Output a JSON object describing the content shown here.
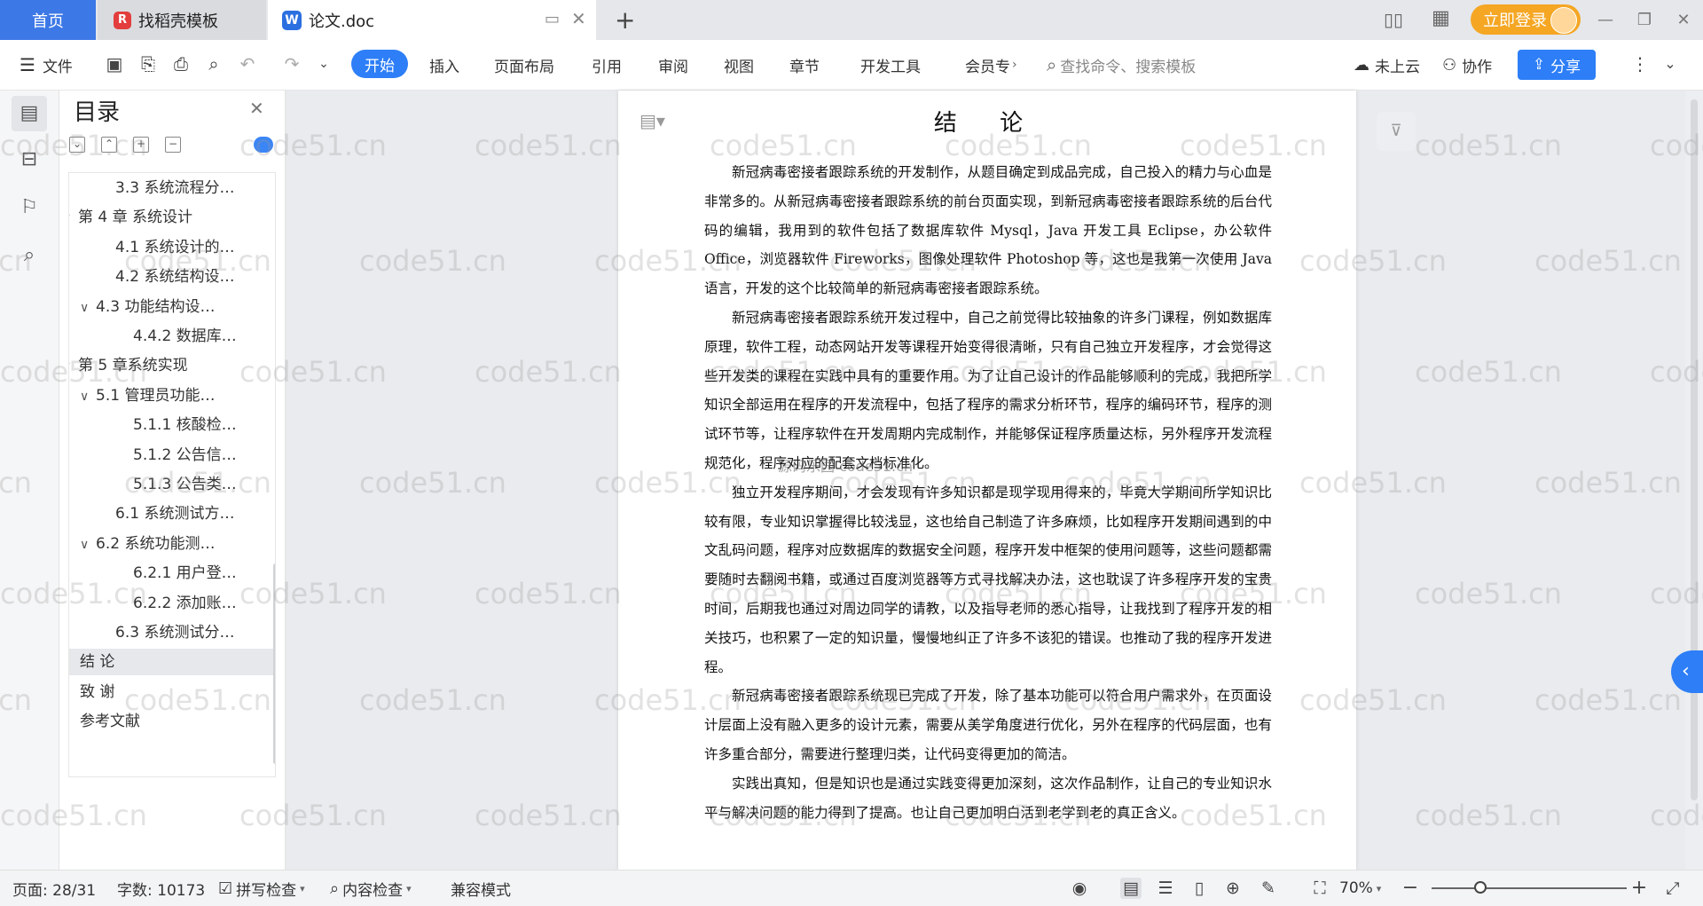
{
  "titlebar": {
    "tab_home": "首页",
    "tab_template": "找稻壳模板",
    "tab_document": "论文.doc",
    "login_label": "立即登录"
  },
  "toolbar": {
    "file_label": "文件",
    "tabs": [
      "开始",
      "插入",
      "页面布局",
      "引用",
      "审阅",
      "视图",
      "章节",
      "开发工具",
      "会员专"
    ],
    "search_placeholder": "查找命令、搜索模板",
    "cloud_label": "未上云",
    "collab_label": "协作",
    "share_label": "分享"
  },
  "toc": {
    "title": "目录",
    "items": [
      {
        "label": "3.3 系统流程分…",
        "level": 3,
        "caret": false,
        "selected": false
      },
      {
        "label": "第 4 章  系统设计",
        "level": 1,
        "caret": true,
        "selected": false
      },
      {
        "label": "4.1  系统设计的…",
        "level": 3,
        "caret": false,
        "selected": false
      },
      {
        "label": "4.2  系统结构设…",
        "level": 3,
        "caret": false,
        "selected": false
      },
      {
        "label": "4.3 功能结构设…",
        "level": 2,
        "caret": true,
        "selected": false
      },
      {
        "label": "4.4.2  数据库…",
        "level": 4,
        "caret": false,
        "selected": false
      },
      {
        "label": "第 5 章系统实现",
        "level": 1,
        "caret": true,
        "selected": false
      },
      {
        "label": "5.1 管理员功能…",
        "level": 2,
        "caret": true,
        "selected": false
      },
      {
        "label": "5.1.1  核酸检…",
        "level": 5,
        "caret": false,
        "selected": false
      },
      {
        "label": "5.1.2  公告信…",
        "level": 5,
        "caret": false,
        "selected": false
      },
      {
        "label": "5.1.3 公告类…",
        "level": 5,
        "caret": false,
        "selected": false
      },
      {
        "label": "6.1 系统测试方…",
        "level": 3,
        "caret": false,
        "selected": false
      },
      {
        "label": "6.2  系统功能测…",
        "level": 2,
        "caret": true,
        "selected": false
      },
      {
        "label": "6.2.1  用户登…",
        "level": 5,
        "caret": false,
        "selected": false
      },
      {
        "label": "6.2.2  添加账…",
        "level": 5,
        "caret": false,
        "selected": false
      },
      {
        "label": "6.3  系统测试分…",
        "level": 3,
        "caret": false,
        "selected": false
      },
      {
        "label": "结    论",
        "level": 1,
        "caret": false,
        "selected": true
      },
      {
        "label": "致    谢",
        "level": 1,
        "caret": false,
        "selected": false
      },
      {
        "label": "参考文献",
        "level": 1,
        "caret": false,
        "selected": false
      }
    ]
  },
  "document": {
    "title": "结  论",
    "paragraphs": [
      "新冠病毒密接者跟踪系统的开发制作，从题目确定到成品完成，自己投入的精力与心血是非常多的。从新冠病毒密接者跟踪系统的前台页面实现，到新冠病毒密接者跟踪系统的后台代码的编辑，我用到的软件包括了数据库软件 Mysql，Java 开发工具 Eclipse，办公软件 Office，浏览器软件 Fireworks，图像处理软件 Photoshop 等，这也是我第一次使用 Java 语言，开发的这个比较简单的新冠病毒密接者跟踪系统。",
      "新冠病毒密接者跟踪系统开发过程中，自己之前觉得比较抽象的许多门课程，例如数据库原理，软件工程，动态网站开发等课程开始变得很清晰，只有自己独立开发程序，才会觉得这些开发类的课程在实践中具有的重要作用。为了让自己设计的作品能够顺利的完成，我把所学知识全部运用在程序的开发流程中，包括了程序的需求分析环节，程序的编码环节，程序的测试环节等，让程序软件在开发周期内完成制作，并能够保证程序质量达标，另外程序开发流程规范化，程序对应的配套文档标准化。",
      "独立开发程序期间，才会发现有许多知识都是现学现用得来的，毕竟大学期间所学知识比较有限，专业知识掌握得比较浅显，这也给自己制造了许多麻烦，比如程序开发期间遇到的中文乱码问题，程序对应数据库的数据安全问题，程序开发中框架的使用问题等，这些问题都需要随时去翻阅书籍，或通过百度浏览器等方式寻找解决办法，这也耽误了许多程序开发的宝贵时间，后期我也通过对周边同学的请教，以及指导老师的悉心指导，让我找到了程序开发的相关技巧，也积累了一定的知识量，慢慢地纠正了许多不该犯的错误。也推动了我的程序开发进程。",
      "新冠病毒密接者跟踪系统现已完成了开发，除了基本功能可以符合用户需求外，在页面设计层面上没有融入更多的设计元素，需要从美学角度进行优化，另外在程序的代码层面，也有许多重合部分，需要进行整理归类，让代码变得更加的简洁。",
      "实践出真知，但是知识也是通过实践变得更加深刻，这次作品制作，让自己的专业知识水平与解决问题的能力得到了提高。也让自己更加明白活到老学到老的真正含义。"
    ],
    "overlay_text": "源码乐园 code51.cn"
  },
  "watermark": "code51.cn",
  "statusbar": {
    "page": "页面: 28/31",
    "words": "字数: 10173",
    "spell_check": "拼写检查",
    "content_check": "内容检查",
    "compat_mode": "兼容模式",
    "zoom": "70%",
    "zoom_level": 0.25
  },
  "colors": {
    "accent": "#2d7ef7",
    "login": "#f5a623",
    "home_tab": "#3c78e6"
  }
}
